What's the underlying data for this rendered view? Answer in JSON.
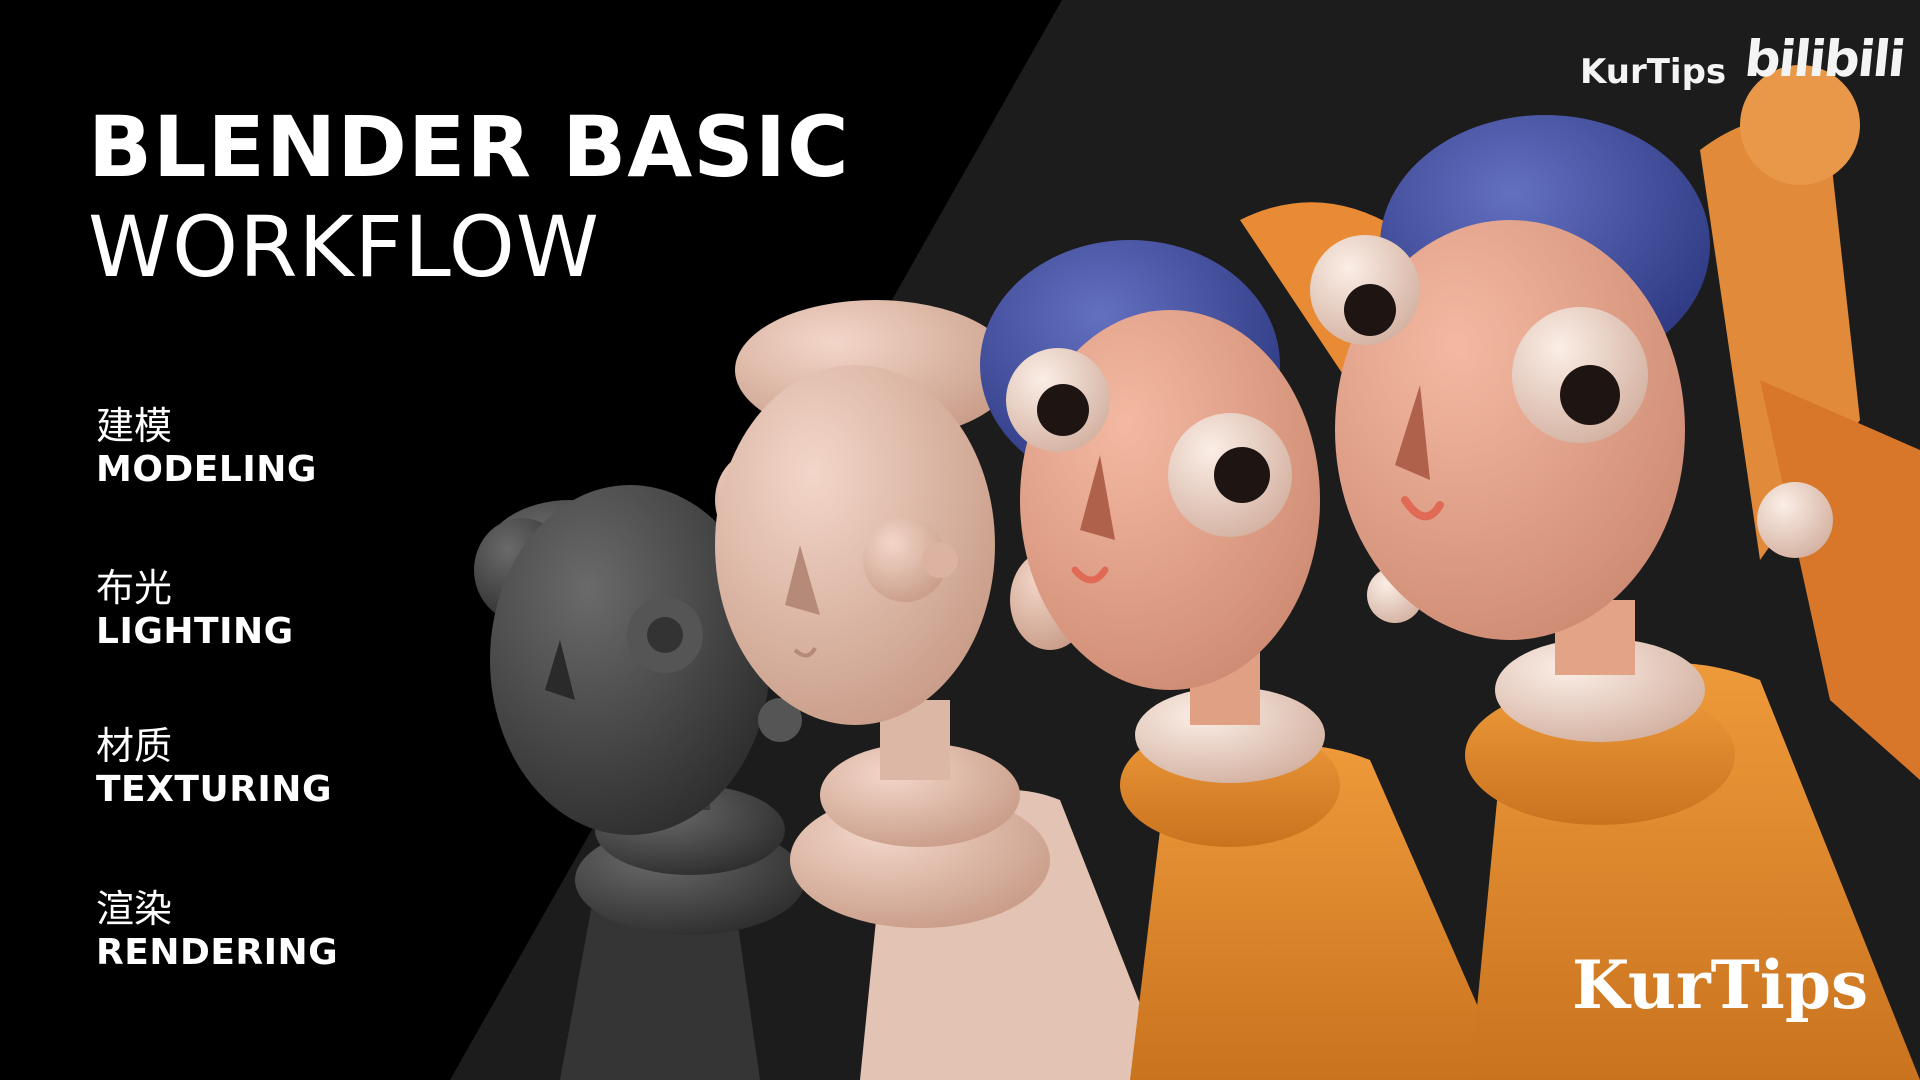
{
  "title": {
    "main": "BLENDER BASIC",
    "sub": "WORKFLOW"
  },
  "steps": [
    {
      "zh": "建模",
      "en": "MODELING"
    },
    {
      "zh": "布光",
      "en": "LIGHTING"
    },
    {
      "zh": "材质",
      "en": "TEXTURING"
    },
    {
      "zh": "渲染",
      "en": "RENDERING"
    }
  ],
  "brand": {
    "top_text": "KurTips",
    "platform_logo": "bilibili",
    "bottom_text": "KurTips"
  },
  "colors": {
    "background_black": "#000000",
    "background_dark": "#1c1c1c",
    "clay_gray": "#4a4a4a",
    "clay_pink": "#e6bfae",
    "skin": "#e7a48c",
    "turban_blue": "#3f4ea0",
    "robe_orange": "#e8862c",
    "pearl": "#efd6c8"
  },
  "figures": [
    {
      "stage": "modeling-clay",
      "icon": "figure-gray"
    },
    {
      "stage": "lighting-clay",
      "icon": "figure-pink"
    },
    {
      "stage": "textured",
      "icon": "figure-textured"
    },
    {
      "stage": "rendered",
      "icon": "figure-rendered"
    }
  ]
}
